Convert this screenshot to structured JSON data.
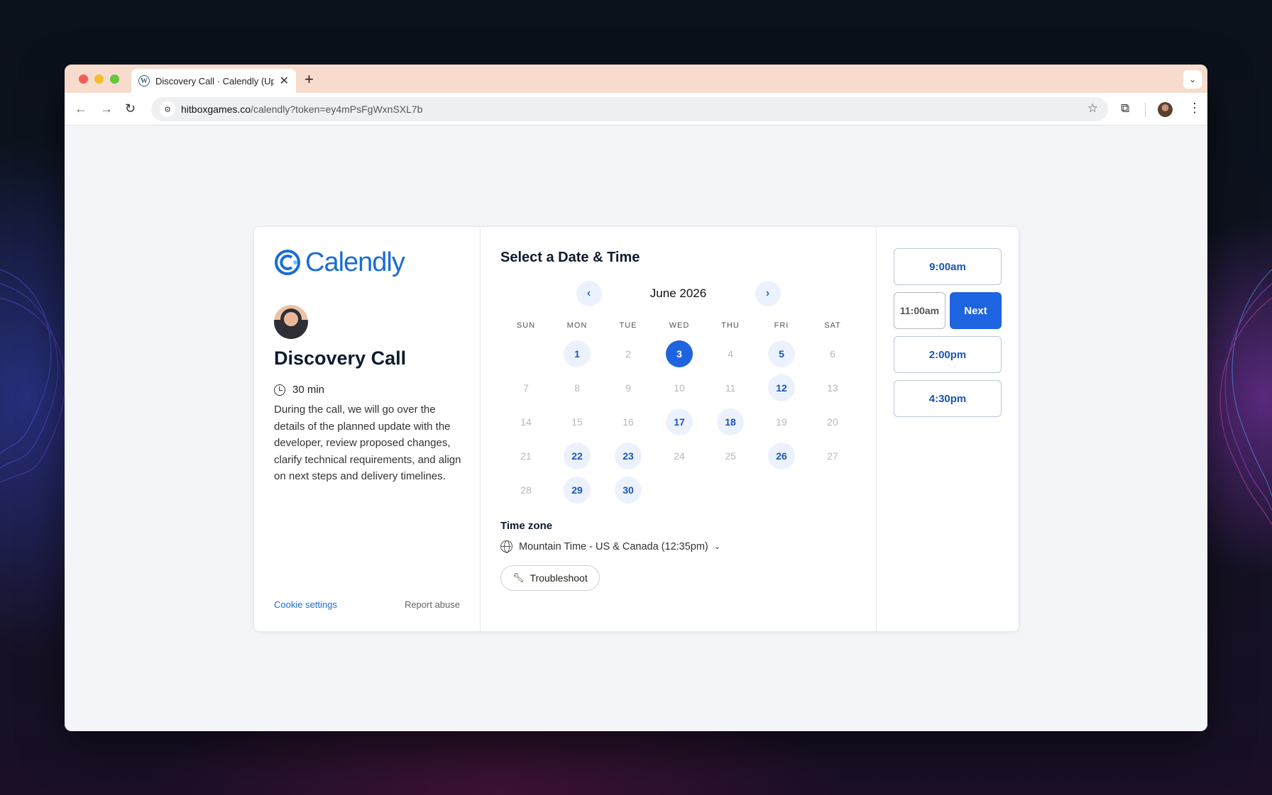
{
  "browser": {
    "tab_title": "Discovery Call · Calendly (Up",
    "tab_close": "✕",
    "new_tab": "+",
    "tab_dropdown": "⌄",
    "url_host": "hitboxgames.co",
    "url_path": "/calendly?token=ey4mPsFgWxnSXL7b",
    "back": "←",
    "forward": "→",
    "reload": "↻",
    "star": "☆",
    "extensions": "⧉",
    "menu": "⋮"
  },
  "event": {
    "logo_text": "Calendly",
    "title": "Discovery Call",
    "duration": "30 min",
    "description": "During the call, we will go over the details of the planned update with the developer, review proposed changes, clarify technical requirements, and align on next steps and delivery timelines."
  },
  "footer": {
    "cookie": "Cookie settings",
    "report": "Report abuse"
  },
  "calendar": {
    "heading": "Select a Date & Time",
    "month": "June 2026",
    "prev": "‹",
    "next": "›",
    "weekdays": [
      "SUN",
      "MON",
      "TUE",
      "WED",
      "THU",
      "FRI",
      "SAT"
    ],
    "leading_blanks": 1,
    "days": 30,
    "available": [
      1,
      5,
      12,
      17,
      18,
      22,
      23,
      26,
      29,
      30
    ],
    "selected": 3
  },
  "timezone": {
    "label": "Time zone",
    "value": "Mountain Time - US & Canada (12:35pm)",
    "chevron": "⌄"
  },
  "troubleshoot": "Troubleshoot",
  "slots": {
    "slot1": "9:00am",
    "chosen": "11:00am",
    "next_label": "Next",
    "slot3": "2:00pm",
    "slot4": "4:30pm"
  },
  "colors": {
    "brand": "#1a6dd6",
    "selected": "#1e63e0",
    "available_bg": "#ecf2fd"
  }
}
